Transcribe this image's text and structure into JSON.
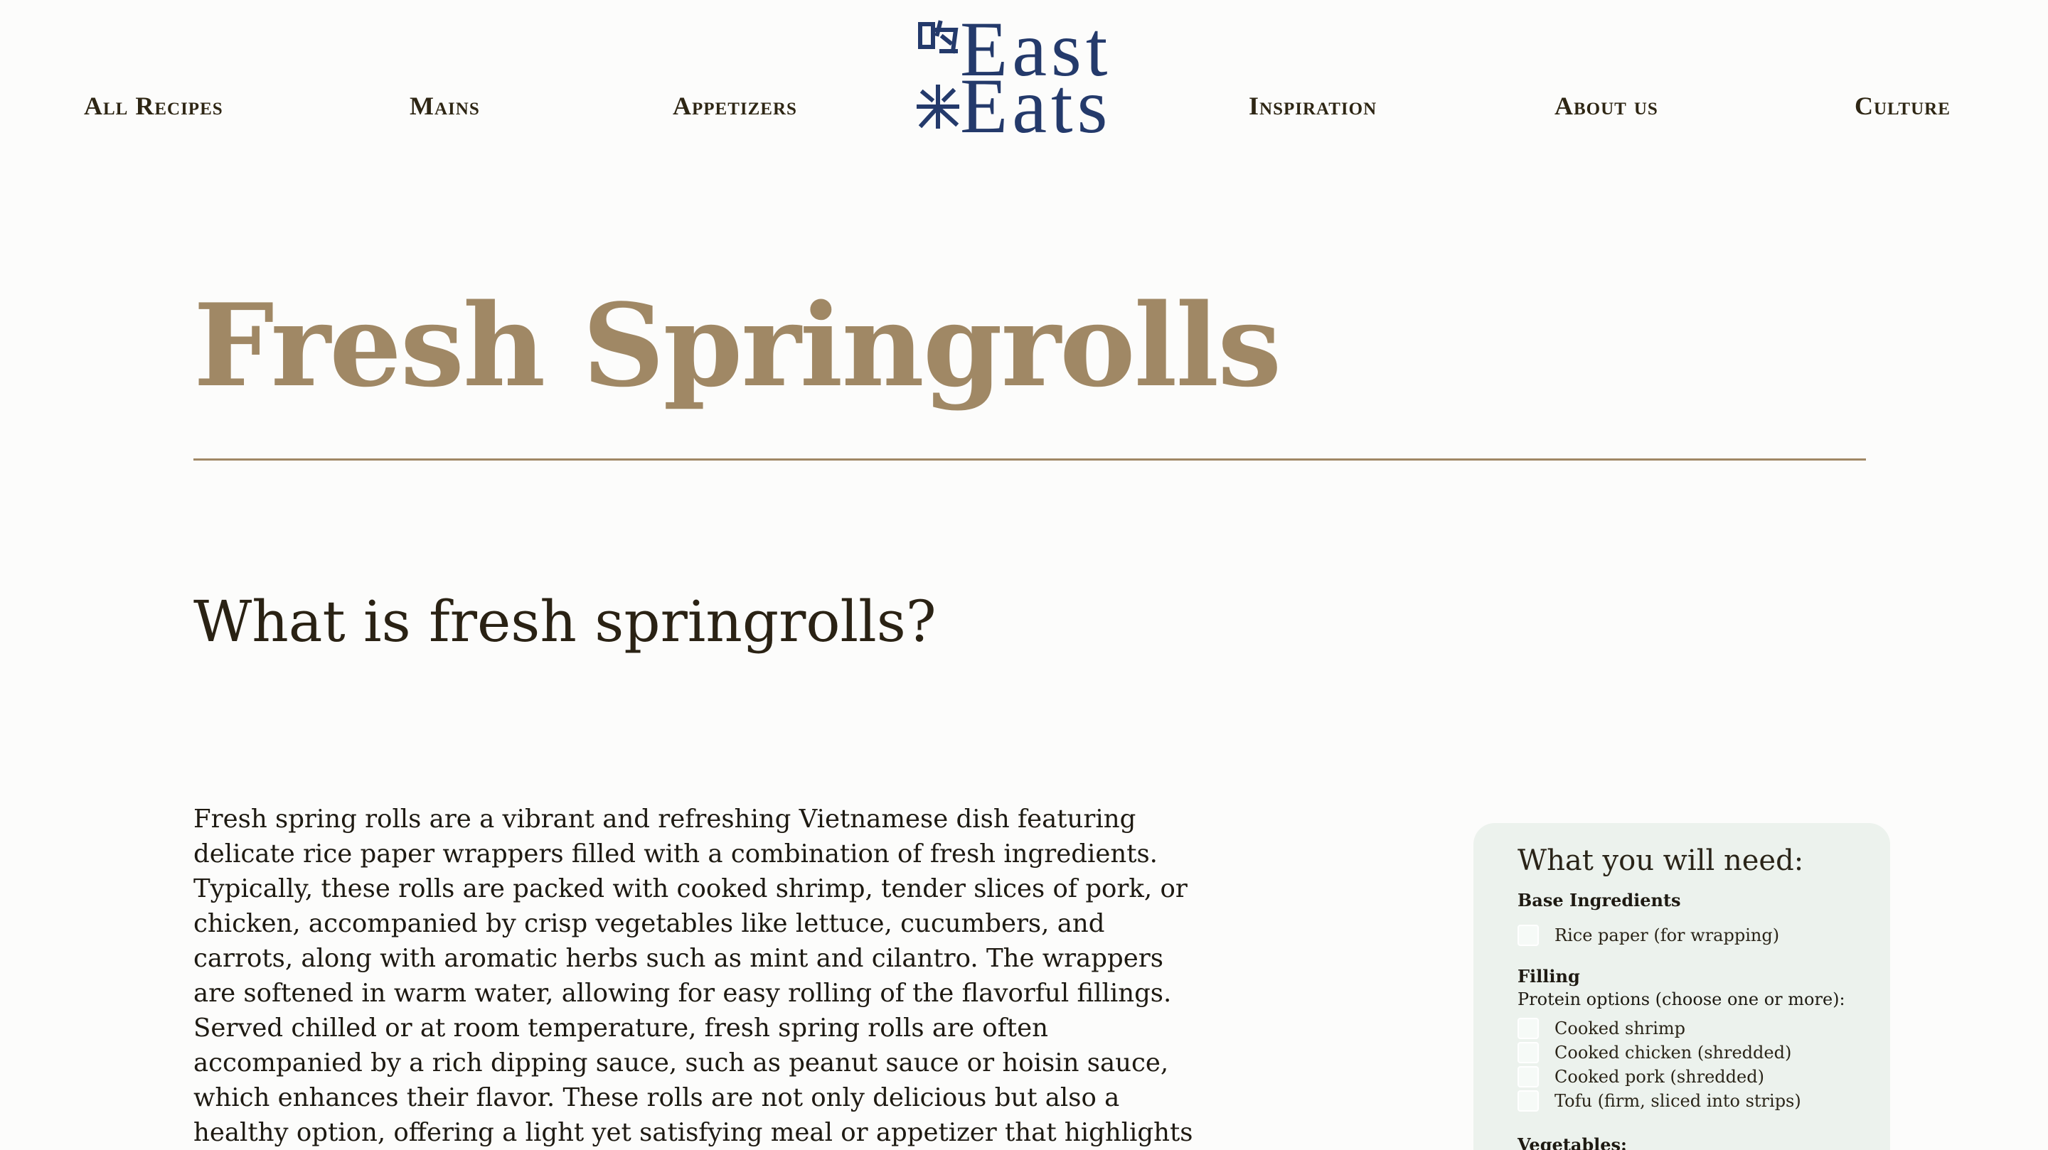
{
  "nav": {
    "all_recipes": "All Recipes",
    "mains": "Mains",
    "appetizers": "Appetizers",
    "inspiration": "Inspiration",
    "about_us": "About us",
    "culture": "Culture"
  },
  "logo": {
    "line1": "East",
    "line2": "Eats",
    "icon": "chinese-characters-icon",
    "color": "#243a6b"
  },
  "page": {
    "title": "Fresh Springrolls",
    "section_heading": "What is fresh springrolls?",
    "intro": "Fresh spring rolls are a vibrant and refreshing Vietnamese dish featuring delicate rice paper wrappers filled with a combination of fresh ingredients. Typically, these rolls are packed with cooked shrimp, tender slices of pork, or chicken, accompanied by crisp vegetables like lettuce, cucumbers, and carrots, along with aromatic herbs such as mint and cilantro. The wrappers are softened in warm water, allowing for easy rolling of the flavorful fillings. Served chilled or at room temperature, fresh spring rolls are often accompanied by a rich dipping sauce, such as peanut sauce or hoisin sauce, which enhances their flavor. These rolls are not only delicious but also a healthy option, offering a light yet satisfying meal or appetizer that highlights the fresh, vibrant flavors of Southeast Asian cuisine."
  },
  "colors": {
    "accent": "#a08865",
    "card_bg": "#ecf2ed",
    "brand": "#243a6b"
  },
  "ingredients": {
    "title": "What you will need:",
    "base": {
      "title": "Base Ingredients",
      "items": [
        "Rice paper (for wrapping)"
      ]
    },
    "filling": {
      "title": "Filling",
      "subtitle": "Protein options (choose one or more):",
      "items": [
        "Cooked shrimp",
        "Cooked chicken (shredded)",
        "Cooked pork (shredded)",
        "Tofu (firm, sliced into strips)"
      ]
    },
    "vegetables": {
      "title": "Vegetables:"
    }
  }
}
